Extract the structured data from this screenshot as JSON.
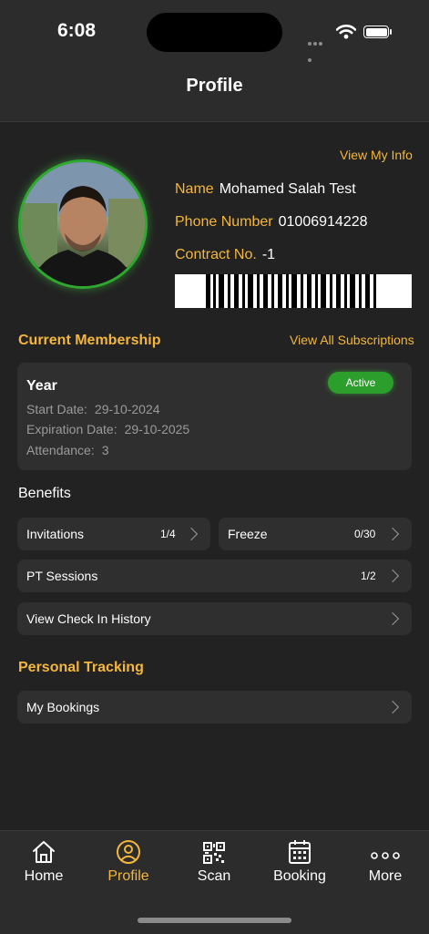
{
  "status_bar": {
    "time": "6:08"
  },
  "header": {
    "title": "Profile"
  },
  "profile": {
    "view_info_label": "View My Info",
    "name_label": "Name",
    "name_value": "Mohamed Salah Test",
    "phone_label": "Phone Number",
    "phone_value": "01006914228",
    "contract_label": "Contract No.",
    "contract_value": "-1"
  },
  "membership": {
    "section_title": "Current Membership",
    "view_all_label": "View All Subscriptions",
    "plan_name": "Year",
    "status": "Active",
    "start_label": "Start Date:",
    "start_value": "29-10-2024",
    "expiration_label": "Expiration Date:",
    "expiration_value": "29-10-2025",
    "attendance_label": "Attendance:",
    "attendance_value": "3"
  },
  "benefits": {
    "title": "Benefits",
    "invitations": {
      "label": "Invitations",
      "count": "1/4"
    },
    "freeze": {
      "label": "Freeze",
      "count": "0/30"
    },
    "pt_sessions": {
      "label": "PT Sessions",
      "count": "1/2"
    },
    "check_in_history": {
      "label": "View Check In History"
    }
  },
  "tracking": {
    "title": "Personal Tracking",
    "my_bookings": {
      "label": "My Bookings"
    }
  },
  "tabs": [
    {
      "label": "Home",
      "icon": "home-icon"
    },
    {
      "label": "Profile",
      "icon": "user-circle-icon",
      "active": true
    },
    {
      "label": "Scan",
      "icon": "qr-code-icon"
    },
    {
      "label": "Booking",
      "icon": "calendar-icon"
    },
    {
      "label": "More",
      "icon": "more-dots-icon"
    }
  ],
  "colors": {
    "accent": "#f4b63c",
    "active_green": "#2c9e2c",
    "background": "#222222",
    "card": "#2f2f2f"
  }
}
